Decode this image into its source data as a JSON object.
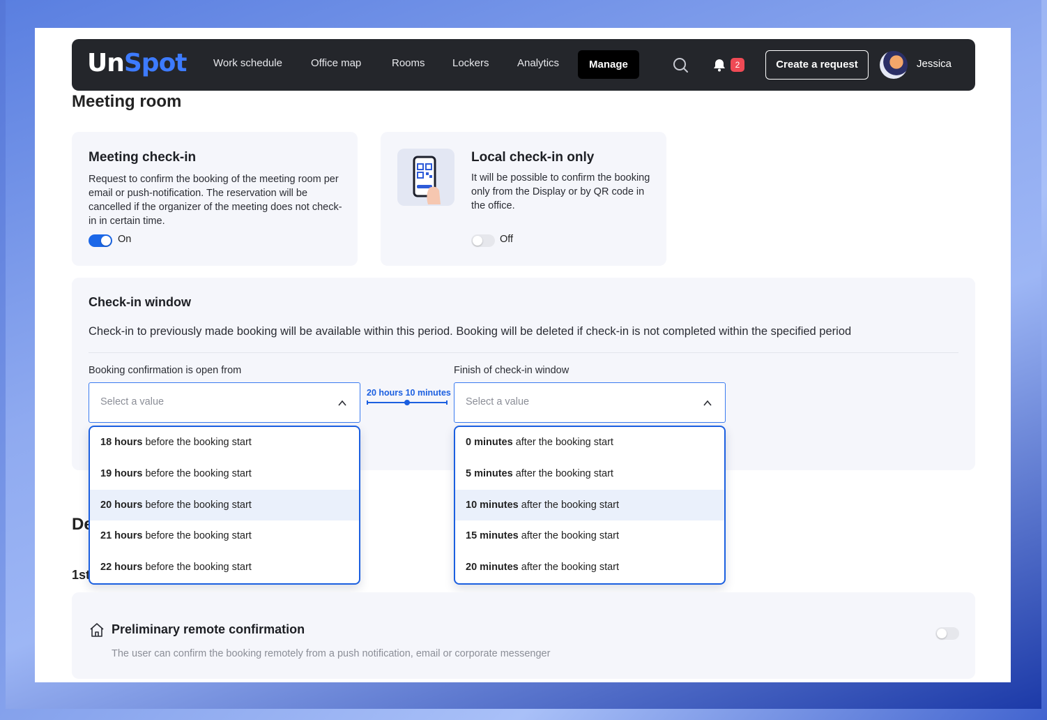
{
  "app": {
    "logo_un": "Un",
    "logo_spot": "Spot"
  },
  "nav": {
    "items": [
      {
        "label": "Work schedule"
      },
      {
        "label": "Office map"
      },
      {
        "label": "Rooms"
      },
      {
        "label": "Lockers"
      },
      {
        "label": "Analytics"
      },
      {
        "label": "Manage",
        "active": true
      }
    ],
    "notification_count": "2",
    "create_button": "Create a request",
    "user_name": "Jessica"
  },
  "page": {
    "title": "Meeting room"
  },
  "meeting_checkin": {
    "title": "Meeting check-in",
    "description": "Request to confirm the booking of the meeting room per email or push-notification. The reservation will be cancelled if the organizer of the meeting does not check-in in certain time.",
    "toggle_state": "On"
  },
  "local_checkin": {
    "title": "Local check-in only",
    "description": "It will be possible to confirm the booking only from the Display or by QR code in the office.",
    "toggle_state": "Off"
  },
  "checkin_window": {
    "title": "Check-in window",
    "description": "Check-in to previously made booking will be available within this period. Booking will be deleted if check-in is not completed within the specified period",
    "from_label": "Booking confirmation is open from",
    "finish_label": "Finish of check-in window",
    "from_placeholder": "Select a value",
    "finish_placeholder": "Select a value",
    "range_text": "20 hours 10 minutes",
    "from_options": [
      {
        "bold": "18 hours",
        "rest": " before the booking start"
      },
      {
        "bold": "19 hours",
        "rest": " before the booking start"
      },
      {
        "bold": "20 hours",
        "rest": " before the booking start",
        "highlighted": true
      },
      {
        "bold": "21 hours",
        "rest": " before the booking start"
      },
      {
        "bold": "22 hours",
        "rest": " before the booking start"
      }
    ],
    "finish_options": [
      {
        "bold": "0 minutes",
        "rest": " after the booking start"
      },
      {
        "bold": "5 minutes",
        "rest": " after the booking start"
      },
      {
        "bold": "10 minutes",
        "rest": " after the booking start",
        "highlighted": true
      },
      {
        "bold": "15 minutes",
        "rest": " after the booking start"
      },
      {
        "bold": "20 minutes",
        "rest": " after the booking start"
      }
    ]
  },
  "partial_hidden": {
    "section_heading_fragment": "De",
    "subheading_fragment": "1st"
  },
  "preliminary": {
    "title": "Preliminary remote confirmation",
    "description": "The user can confirm the booking remotely from a push notification, email or corporate messenger"
  },
  "colors": {
    "accent": "#1b67e8",
    "nav_bg": "#24262b",
    "badge": "#ef4a55",
    "card_bg": "#f5f6fb"
  }
}
